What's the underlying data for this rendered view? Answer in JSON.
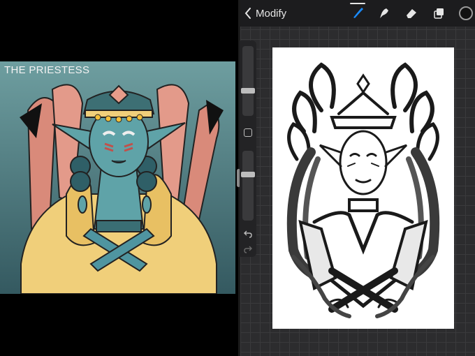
{
  "reference": {
    "title": "THE PRIESTESS"
  },
  "topbar": {
    "back_label": "Modify",
    "tools": [
      {
        "name": "brush-icon",
        "active": true
      },
      {
        "name": "smudge-icon",
        "active": false
      },
      {
        "name": "eraser-icon",
        "active": false
      },
      {
        "name": "layers-icon",
        "active": false
      }
    ],
    "color_swatch": "#111111"
  },
  "sidebar": {
    "brush_size_level": 0.4,
    "opacity_level": 0.4
  },
  "theme": {
    "accent": "#1a8cff",
    "canvas_bg": "#2c2c2e",
    "ref_bg_top": "#6a9a9d",
    "ref_bg_bottom": "#355a60"
  }
}
